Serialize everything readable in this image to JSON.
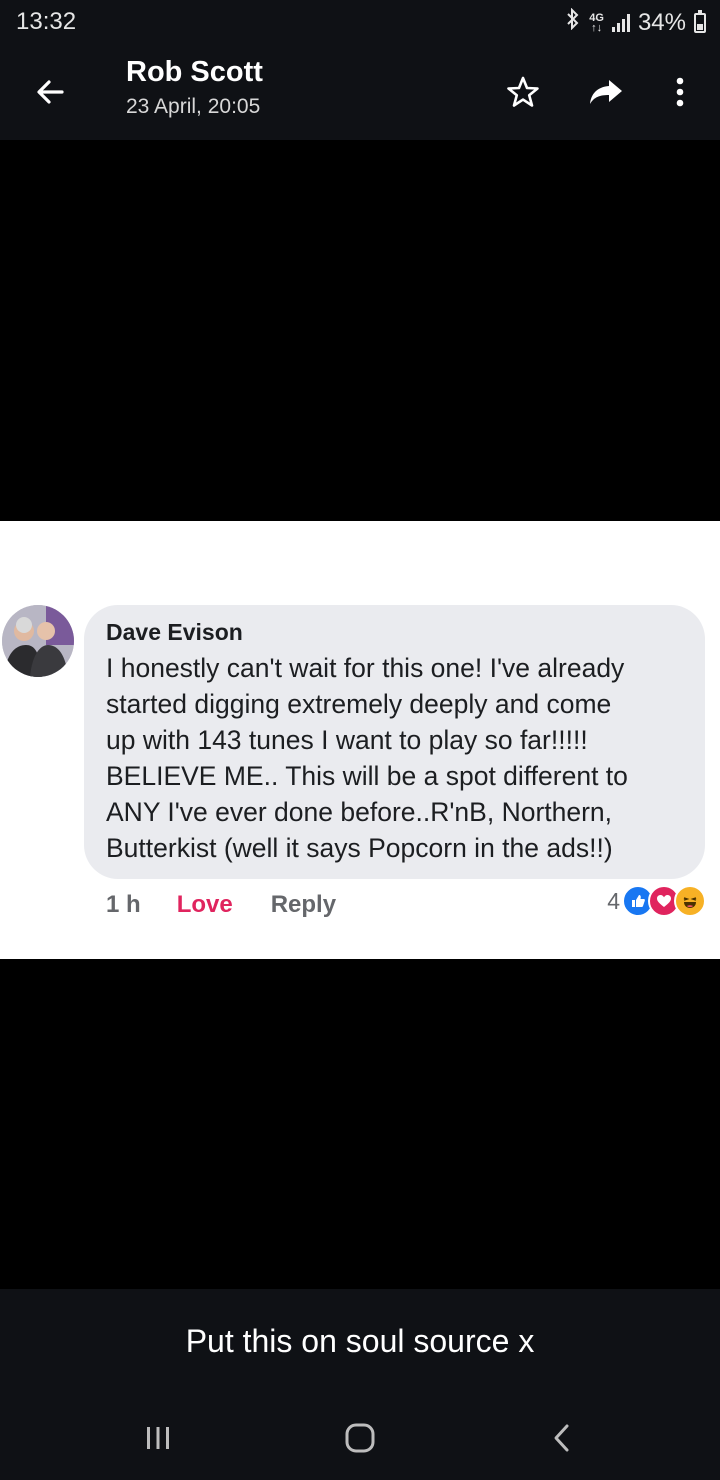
{
  "status": {
    "time": "13:32",
    "network_top": "4G",
    "network_bottom": "↑↓",
    "battery": "34%",
    "battery_level": 0.34,
    "icons": [
      "bluetooth-icon",
      "signal-icon",
      "battery-icon"
    ]
  },
  "header": {
    "name": "Rob Scott",
    "date": "23 April, 20:05",
    "icons": [
      "back-arrow-icon",
      "star-icon",
      "forward-icon",
      "more-vert-icon"
    ]
  },
  "comment": {
    "author": "Dave Evison",
    "text": "I honestly can't wait for this one! I've already\nstarted digging extremely deeply and come\nup with 143 tunes I want to play so far!!!!!\nBELIEVE ME.. This will be a spot different to\nANY I've ever done before..R'nB, Northern,\nButterkist (well it says Popcorn in the ads!!)",
    "time": "1 h",
    "love_label": "Love",
    "reply_label": "Reply",
    "reaction_count": "4",
    "reactions": [
      "like-icon",
      "love-icon",
      "haha-icon"
    ],
    "colors": {
      "love": "#e0245e",
      "like": "#1877f2",
      "haha": "#f7b125"
    }
  },
  "caption": "Put this on soul source x",
  "nav": {
    "icons": [
      "recents-icon",
      "home-icon",
      "back-icon"
    ]
  }
}
